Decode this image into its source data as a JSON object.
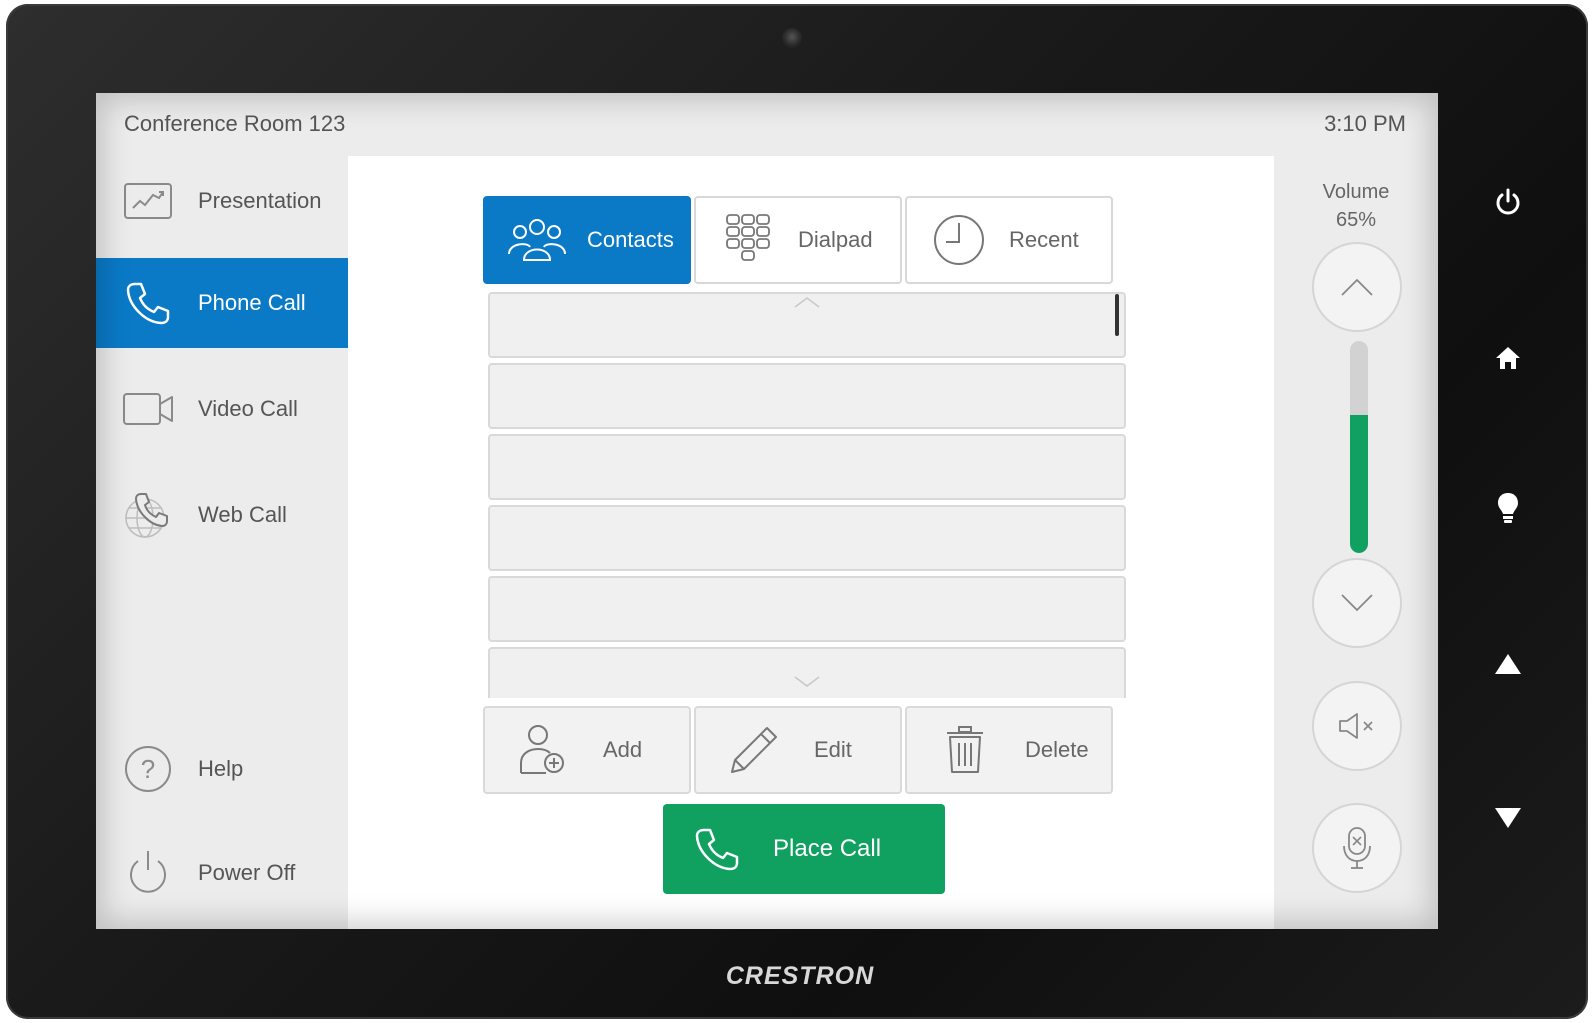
{
  "device": {
    "brand": "CRESTRON"
  },
  "header": {
    "room_name": "Conference Room 123",
    "time": "3:10 PM"
  },
  "sidebar": {
    "items": [
      {
        "label": "Presentation",
        "icon": "presentation-icon",
        "active": false
      },
      {
        "label": "Phone Call",
        "icon": "phone-icon",
        "active": true
      },
      {
        "label": "Video Call",
        "icon": "video-camera-icon",
        "active": false
      },
      {
        "label": "Web Call",
        "icon": "web-call-icon",
        "active": false
      },
      {
        "label": "Help",
        "icon": "help-icon",
        "active": false
      },
      {
        "label": "Power Off",
        "icon": "power-icon",
        "active": false
      }
    ]
  },
  "tabs": [
    {
      "label": "Contacts",
      "icon": "contacts-icon",
      "active": true
    },
    {
      "label": "Dialpad",
      "icon": "dialpad-icon",
      "active": false
    },
    {
      "label": "Recent",
      "icon": "clock-icon",
      "active": false
    }
  ],
  "contacts_list": {
    "rows": [
      "",
      "",
      "",
      "",
      "",
      ""
    ]
  },
  "actions": [
    {
      "label": "Add",
      "icon": "add-contact-icon"
    },
    {
      "label": "Edit",
      "icon": "pencil-icon"
    },
    {
      "label": "Delete",
      "icon": "trash-icon"
    }
  ],
  "place_call": {
    "label": "Place Call",
    "icon": "phone-icon"
  },
  "volume": {
    "label": "Volume",
    "level_text": "65%",
    "level": 0.65
  },
  "hardware_buttons": [
    "power-icon",
    "home-icon",
    "lightbulb-icon",
    "up-triangle-icon",
    "down-triangle-icon"
  ],
  "colors": {
    "accent_blue": "#0a7ac7",
    "call_green": "#10a060",
    "bezel": "#1a1a1a"
  }
}
